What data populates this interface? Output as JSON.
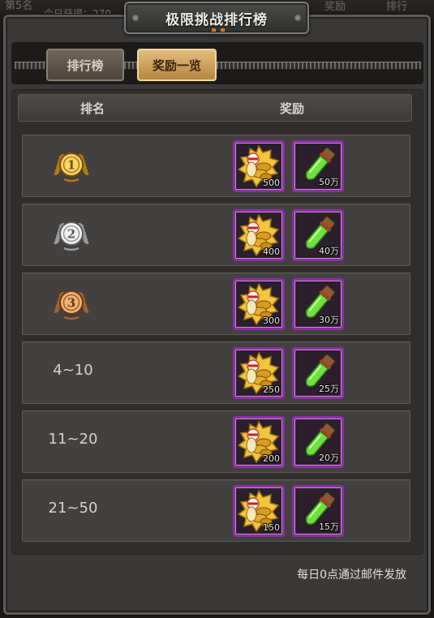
{
  "background": {
    "left_text": "第5名",
    "sub_text": "今日获得：270",
    "right_tab1": "奖励",
    "right_tab2": "排行"
  },
  "window": {
    "title": "极限挑战排行榜"
  },
  "tabs": [
    {
      "label": "排行榜",
      "active": false
    },
    {
      "label": "奖励一览",
      "active": true
    }
  ],
  "table": {
    "col_rank": "排名",
    "col_reward": "奖励"
  },
  "rows": [
    {
      "rank_type": "medal",
      "medal": "gold",
      "rank": "1",
      "reward1_icon": "gold-coin-pile-icon",
      "reward1_qty": "500",
      "reward2_icon": "green-potion-icon",
      "reward2_qty": "50万"
    },
    {
      "rank_type": "medal",
      "medal": "silver",
      "rank": "2",
      "reward1_icon": "gold-coin-pile-icon",
      "reward1_qty": "400",
      "reward2_icon": "green-potion-icon",
      "reward2_qty": "40万"
    },
    {
      "rank_type": "medal",
      "medal": "bronze",
      "rank": "3",
      "reward1_icon": "gold-coin-pile-icon",
      "reward1_qty": "300",
      "reward2_icon": "green-potion-icon",
      "reward2_qty": "30万"
    },
    {
      "rank_type": "text",
      "rank": "4~10",
      "reward1_icon": "gold-coin-pile-icon",
      "reward1_qty": "250",
      "reward2_icon": "green-potion-icon",
      "reward2_qty": "25万"
    },
    {
      "rank_type": "text",
      "rank": "11~20",
      "reward1_icon": "gold-coin-pile-icon",
      "reward1_qty": "200",
      "reward2_icon": "green-potion-icon",
      "reward2_qty": "20万"
    },
    {
      "rank_type": "text",
      "rank": "21~50",
      "reward1_icon": "gold-coin-pile-icon",
      "reward1_qty": "150",
      "reward2_icon": "green-potion-icon",
      "reward2_qty": "15万"
    }
  ],
  "footer": {
    "note": "每日0点通过邮件发放"
  },
  "colors": {
    "rare_border": "#8b2fa3",
    "active_tab": "#d9a95a",
    "gold": "#e3b53a",
    "silver": "#c9c9c9",
    "bronze": "#c98a4b"
  }
}
